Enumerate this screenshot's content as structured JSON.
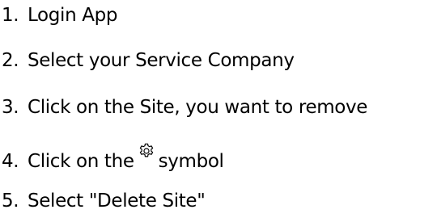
{
  "steps": [
    {
      "number": "1.",
      "text": "Login App"
    },
    {
      "number": "2.",
      "text": "Select your Service Company"
    },
    {
      "number": "3.",
      "text": "Click on the Site, you want to remove"
    },
    {
      "number": "4.",
      "text_before": "Click on the",
      "icon": "gear-icon",
      "text_after": "symbol"
    },
    {
      "number": "5.",
      "text": "Select \"Delete Site\""
    }
  ]
}
